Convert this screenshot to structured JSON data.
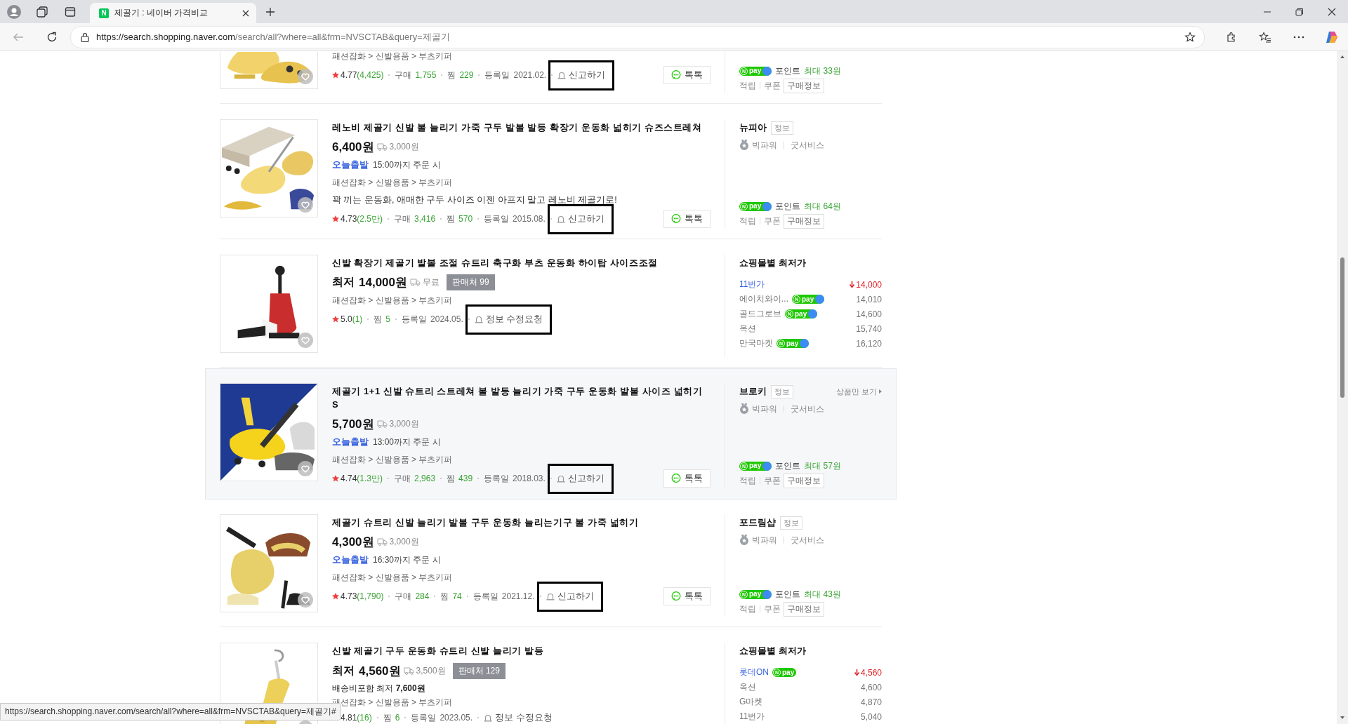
{
  "browser": {
    "tab_title": "제골기 : 네이버 가격비교",
    "favicon": "N",
    "url_host": "https://search.shopping.naver.com",
    "url_path": "/search/all?where=all&frm=NVSCTAB&query=제골기"
  },
  "products": [
    {
      "hovered": false,
      "category": "패션잡화 > 신발용품 > 부츠키퍼",
      "rating": "4.77",
      "reviews": "(4,425)",
      "stats": [
        {
          "kind": "count",
          "label": "구매",
          "value": "1,755"
        },
        {
          "kind": "count",
          "label": "찜",
          "value": "229"
        },
        {
          "kind": "date",
          "label": "등록일",
          "value": "2021.02."
        }
      ],
      "report": {
        "label": "신고하기",
        "marked": true
      },
      "talk": "톡톡",
      "side": {
        "kind": "seller",
        "point": {
          "npay": {
            "mark": "N",
            "text": "pay",
            "plus": true
          },
          "label": "포인트",
          "amount": "최대 33원"
        },
        "actions": [
          "적립",
          "쿠폰"
        ],
        "info_button": "구매정보"
      }
    },
    {
      "hovered": false,
      "title": "레노비 제골기 신발 볼 늘리기 가죽 구두 발볼 발등 확장기 운동화 넓히기 슈즈스트레쳐",
      "price": "6,400원",
      "shipping": "3,000원",
      "delivery": {
        "badge": "오늘출발",
        "text": "15:00까지 주문 시"
      },
      "category": "패션잡화 > 신발용품 > 부츠키퍼",
      "description": "꽉 끼는 운동화, 애매한 구두 사이즈 이젠 아프지 말고 레노비 제골기로!",
      "rating": "4.73",
      "reviews": "(2.5만)",
      "stats": [
        {
          "kind": "count",
          "label": "구매",
          "value": "3,416"
        },
        {
          "kind": "count",
          "label": "찜",
          "value": "570"
        },
        {
          "kind": "date",
          "label": "등록일",
          "value": "2015.08."
        }
      ],
      "report": {
        "label": "신고하기",
        "marked": true
      },
      "talk": "톡톡",
      "side": {
        "kind": "seller",
        "name": "뉴피아",
        "tag": "정보",
        "grades": [
          "빅파워",
          "굿서비스"
        ],
        "point": {
          "npay": {
            "mark": "N",
            "text": "pay",
            "plus": true
          },
          "label": "포인트",
          "amount": "최대 64원"
        },
        "actions": [
          "적립",
          "쿠폰"
        ],
        "info_button": "구매정보"
      }
    },
    {
      "hovered": false,
      "title": "신발 확장기 제골기 발볼 조절 슈트리 축구화 부츠 운동화 하이탑 사이즈조절",
      "price_prefix": "최저",
      "price": "14,000원",
      "shipping": "무료",
      "sellers": "판매처 99",
      "category": "패션잡화 > 신발용품 > 부츠키퍼",
      "rating": "5.0",
      "reviews": "(1)",
      "stats": [
        {
          "kind": "count",
          "label": "찜",
          "value": "5"
        },
        {
          "kind": "date",
          "label": "등록일",
          "value": "2024.05."
        }
      ],
      "report": {
        "label": "정보 수정요청",
        "marked": true
      },
      "side": {
        "kind": "mall_prices",
        "heading": "쇼핑몰별 최저가",
        "malls": [
          {
            "name": "11번가",
            "price": "14,000",
            "lowest": true
          },
          {
            "name": "에이치와이...",
            "npay": {
              "mark": "N",
              "text": "pay",
              "plus": true
            },
            "price": "14,010",
            "lowest": false
          },
          {
            "name": "골드그로브",
            "npay": {
              "mark": "N",
              "text": "pay",
              "plus": true
            },
            "price": "14,600",
            "lowest": false
          },
          {
            "name": "옥션",
            "price": "15,740",
            "lowest": false
          },
          {
            "name": "만국마켓",
            "npay": {
              "mark": "N",
              "text": "pay",
              "plus": true
            },
            "price": "16,120",
            "lowest": false
          }
        ]
      }
    },
    {
      "hovered": true,
      "title": "제골기 1+1 신발 슈트리 스트레쳐 볼 발등 늘리기 가죽 구두 운동화 발볼 사이즈 넓히기 S",
      "price": "5,700원",
      "shipping": "3,000원",
      "delivery": {
        "badge": "오늘출발",
        "text": "13:00까지 주문 시"
      },
      "category": "패션잡화 > 신발용품 > 부츠키퍼",
      "rating": "4.74",
      "reviews": "(1.3만)",
      "stats": [
        {
          "kind": "count",
          "label": "구매",
          "value": "2,963"
        },
        {
          "kind": "count",
          "label": "찜",
          "value": "439"
        },
        {
          "kind": "date",
          "label": "등록일",
          "value": "2018.03."
        }
      ],
      "report": {
        "label": "신고하기",
        "marked": true
      },
      "talk": "톡톡",
      "side": {
        "kind": "seller",
        "name": "브로키",
        "tag": "정보",
        "view_only": "상품만 보기",
        "grades": [
          "빅파워",
          "굿서비스"
        ],
        "point": {
          "npay": {
            "mark": "N",
            "text": "pay",
            "plus": true
          },
          "label": "포인트",
          "amount": "최대 57원"
        },
        "actions": [
          "적립",
          "쿠폰"
        ],
        "info_button": "구매정보"
      }
    },
    {
      "hovered": false,
      "title": "제골기 슈트리 신발 늘리기 발볼 구두 운동화 늘리는기구 볼 가죽 넓히기",
      "price": "4,300원",
      "shipping": "3,000원",
      "delivery": {
        "badge": "오늘출발",
        "text": "16:30까지 주문 시"
      },
      "category": "패션잡화 > 신발용품 > 부츠키퍼",
      "rating": "4.73",
      "reviews": "(1,790)",
      "stats": [
        {
          "kind": "count",
          "label": "구매",
          "value": "284"
        },
        {
          "kind": "count",
          "label": "찜",
          "value": "74"
        },
        {
          "kind": "date",
          "label": "등록일",
          "value": "2021.12."
        }
      ],
      "report": {
        "label": "신고하기",
        "marked": true
      },
      "talk": "톡톡",
      "side": {
        "kind": "seller",
        "name": "포드림샵",
        "tag": "정보",
        "grades": [
          "빅파워",
          "굿서비스"
        ],
        "point": {
          "npay": {
            "mark": "N",
            "text": "pay",
            "plus": true
          },
          "label": "포인트",
          "amount": "최대 43원"
        },
        "actions": [
          "적립",
          "쿠폰"
        ],
        "info_button": "구매정보"
      }
    },
    {
      "hovered": false,
      "title": "신발 제골기 구두 운동화 슈트리 신발 늘리기 발등",
      "price_prefix": "최저",
      "price": "4,560원",
      "shipping": "3,500원",
      "sellers": "판매처 129",
      "extra": "배송비포함 최저 **7,600원**",
      "category": "패션잡화 > 신발용품 > 부츠키퍼",
      "rating": "4.81",
      "reviews": "(16)",
      "stats": [
        {
          "kind": "count",
          "label": "찜",
          "value": "6"
        },
        {
          "kind": "date",
          "label": "등록일",
          "value": "2023.05."
        }
      ],
      "report": {
        "label": "정보 수정요청",
        "marked": false
      },
      "side": {
        "kind": "mall_prices",
        "heading": "쇼핑몰별 최저가",
        "malls": [
          {
            "name": "롯데ON",
            "npay": {
              "mark": "N",
              "text": "pay",
              "plus": false
            },
            "price": "4,560",
            "lowest": true
          },
          {
            "name": "옥션",
            "price": "4,600",
            "lowest": false
          },
          {
            "name": "G마켓",
            "price": "4,870",
            "lowest": false
          },
          {
            "name": "11번가",
            "price": "5,040",
            "lowest": false
          }
        ]
      }
    }
  ],
  "status_url": "https://search.shopping.naver.com/search/all?where=all&frm=NVSCTAB&query=제골기#"
}
